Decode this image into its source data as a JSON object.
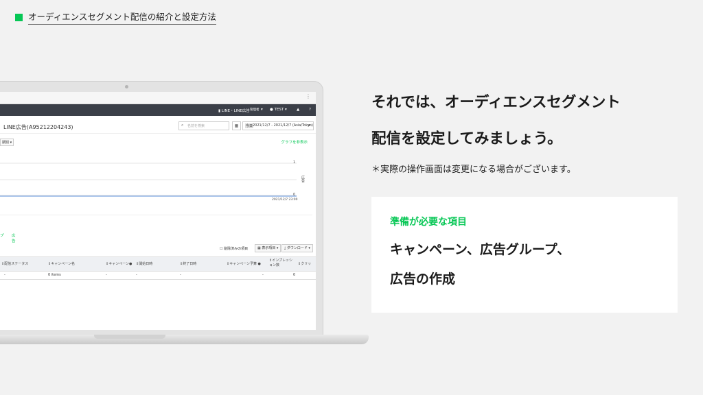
{
  "header": {
    "title": "オーディエンスセグメント配信の紹介と設定方法"
  },
  "screenshot": {
    "nav": {
      "account": "LINE・LINE広告",
      "role": "管理者",
      "user": "TEST"
    },
    "account_title": "LINE広告(A95212204243)",
    "search_placeholder": "名前を検索",
    "date_badge": "今日",
    "date_range": "2021/12/7 - 2021/12/7 (Asia/Tokyo)",
    "metric_chip": "期別",
    "hide_graph": "グラフを非表示",
    "y_tick_top": "1",
    "y_tick_bottom": "0",
    "y_axis_label": "広告",
    "x_tick": "2021/12/7 23:00",
    "tab_group": "プ",
    "tab_ads": "広告",
    "show_deleted": "削除済みの項目",
    "columns_btn": "表示項目",
    "download_btn": "ダウンロード",
    "columns": [
      "配信ステータス",
      "キャンペーン名",
      "キャンペーン",
      "開始日時",
      "終了日時",
      "キャンペーン予算",
      "インプレッション数",
      "クリッ"
    ],
    "row": [
      "-",
      "0 items",
      "-",
      "-",
      "-",
      "-",
      "",
      "0"
    ]
  },
  "right": {
    "headline_line1": "それでは、オーディエンスセグメント",
    "headline_line2": "配信を設定してみましょう。",
    "note": "＊実際の操作画面は変更になる場合がございます。",
    "card_label": "準備が必要な項目",
    "card_line1": "キャンペーン、広告グループ、",
    "card_line2": "広告の作成"
  }
}
